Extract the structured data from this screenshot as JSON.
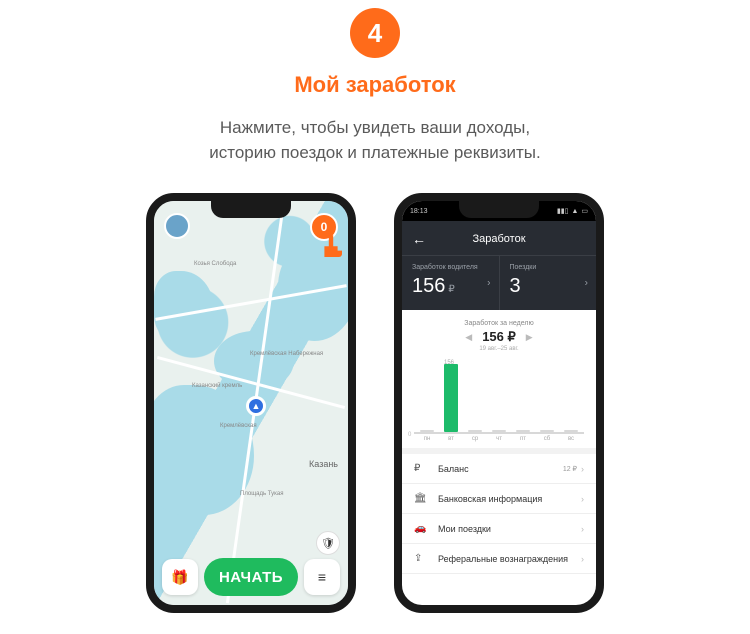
{
  "step": {
    "number": "4",
    "title": "Мой заработок"
  },
  "description": {
    "line1": "Нажмите, чтобы увидеть ваши доходы,",
    "line2": "историю поездок и платежные реквизиты."
  },
  "map_phone": {
    "earn_badge": "0",
    "labels": {
      "kozya": "Козья Слобода",
      "naberezh": "Кремлёвская Набережная",
      "kremlin": "Казанский кремль",
      "kremlevskaya": "Кремлёвская",
      "kazan": "Казань",
      "tukaya": "Площадь Тукая"
    },
    "start_button": "НАЧАТЬ",
    "gift_glyph": "🎁",
    "menu_glyph": "≡",
    "shield_glyph": "🛡"
  },
  "earn_phone": {
    "status_time": "18:13",
    "title": "Заработок",
    "back_glyph": "←",
    "driver_earn_label": "Заработок водителя",
    "driver_earn_value": "156",
    "currency_glyph": "₽",
    "trips_label": "Поездки",
    "trips_value": "3",
    "week_label": "Заработок за неделю",
    "week_amount": "156 ₽",
    "week_range": "19 авг.–25 авг.",
    "nav_left": "◀",
    "nav_right": "▶",
    "chev": "›",
    "list": {
      "balance": {
        "icon": "₽",
        "label": "Баланс",
        "right": "12 ₽"
      },
      "bank": {
        "icon": "🏛",
        "label": "Банковская информация"
      },
      "trips": {
        "icon": "🚗",
        "label": "Мои поездки"
      },
      "referral": {
        "icon": "⇪",
        "label": "Реферальные вознаграждения"
      }
    }
  },
  "chart_data": {
    "type": "bar",
    "title": "Заработок за неделю",
    "categories": [
      "пн",
      "вт",
      "ср",
      "чт",
      "пт",
      "сб",
      "вс"
    ],
    "values": [
      0,
      156,
      0,
      0,
      0,
      0,
      0
    ],
    "ylabel": "₽",
    "ylim": [
      0,
      156
    ],
    "week_total": 156,
    "date_range": "19 авг.–25 авг."
  }
}
